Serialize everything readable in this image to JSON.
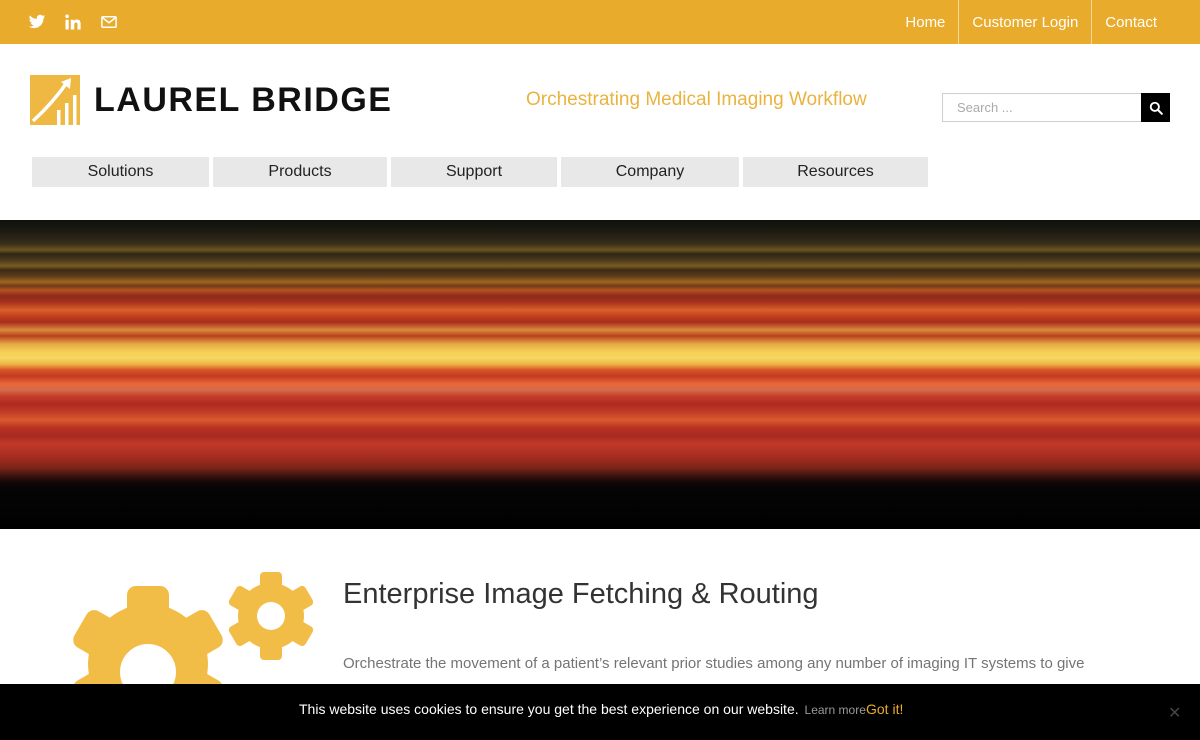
{
  "topbar": {
    "background": "#e8ab2b",
    "social_icons": [
      "twitter-icon",
      "linkedin-icon",
      "email-icon"
    ],
    "links": [
      "Home",
      "Customer Login",
      "Contact"
    ]
  },
  "header": {
    "logo_text": "LAUREL BRIDGE",
    "tagline": "Orchestrating Medical Imaging Workflow",
    "search": {
      "placeholder": "Search ...",
      "value": ""
    }
  },
  "nav": {
    "items": [
      "Solutions",
      "Products",
      "Support",
      "Company",
      "Resources"
    ]
  },
  "feature": {
    "icon": "gears-icon",
    "title": "Enterprise Image Fetching & Routing",
    "text": "Orchestrate the movement of a patient’s relevant prior studies among any number of imaging IT systems to give"
  },
  "cookie_bar": {
    "message": "This website uses cookies to ensure you get the best experience on our website.",
    "learn_more": "Learn more",
    "accept": "Got it!",
    "close": "✕"
  },
  "colors": {
    "accent": "#e8ab2b",
    "tagline": "#eab33f",
    "logo_gold": "#eeb843"
  }
}
